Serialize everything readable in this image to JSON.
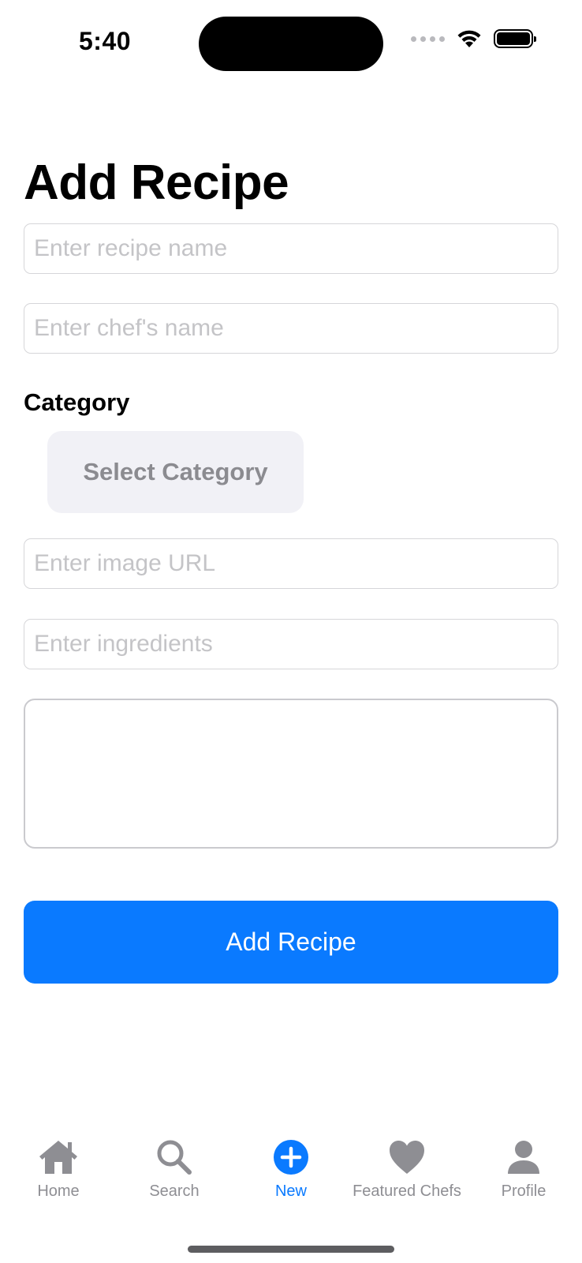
{
  "status_bar": {
    "time": "5:40"
  },
  "page": {
    "title": "Add Recipe"
  },
  "form": {
    "recipe_name": {
      "value": "",
      "placeholder": "Enter recipe name"
    },
    "chef_name": {
      "value": "",
      "placeholder": "Enter chef's name"
    },
    "category_label": "Category",
    "category_button": "Select Category",
    "image_url": {
      "value": "",
      "placeholder": "Enter image URL"
    },
    "ingredients": {
      "value": "",
      "placeholder": "Enter ingredients"
    },
    "instructions": {
      "value": ""
    },
    "submit_label": "Add Recipe"
  },
  "tab_bar": {
    "items": [
      {
        "label": "Home",
        "icon": "house-icon",
        "active": false
      },
      {
        "label": "Search",
        "icon": "magnifying-glass-icon",
        "active": false
      },
      {
        "label": "New",
        "icon": "plus-circle-icon",
        "active": true
      },
      {
        "label": "Featured Chefs",
        "icon": "heart-icon",
        "active": false
      },
      {
        "label": "Profile",
        "icon": "person-icon",
        "active": false
      }
    ]
  },
  "colors": {
    "accent": "#0a7aff",
    "inactive_tab": "#8e8e93",
    "placeholder": "#c4c4c7",
    "category_button_bg": "#f1f1f6"
  }
}
